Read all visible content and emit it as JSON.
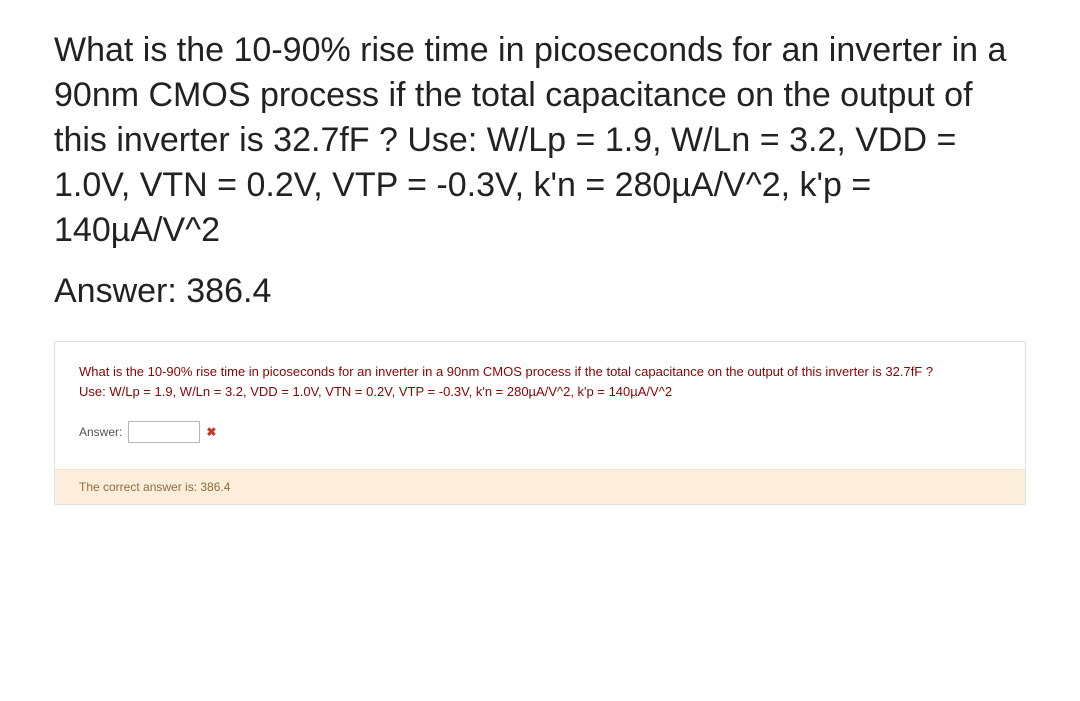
{
  "question": {
    "full_text": "What is the 10-90% rise time in picoseconds for an inverter in a 90nm CMOS process if the total capacitance on the output of this inverter is 32.7fF ? Use: W/Lp = 1.9, W/Ln = 3.2, VDD = 1.0V, VTN = 0.2V, VTP = -0.3V, k'n = 280µA/V^2, k'p = 140µA/V^2"
  },
  "main_answer": {
    "label": "Answer:",
    "value": "386.4",
    "display": "Answer: 386.4"
  },
  "quiz": {
    "question_line1": "What is the 10-90% rise time in picoseconds for an inverter in a 90nm CMOS process if the total capacitance on the output of this inverter is 32.7fF ?",
    "question_line2": "Use: W/Lp = 1.9, W/Ln = 3.2, VDD = 1.0V, VTN = 0.2V, VTP = -0.3V, k'n = 280µA/V^2, k'p = 140µA/V^2",
    "answer_label": "Answer:",
    "input_value": "",
    "feedback": "The correct answer is: 386.4",
    "correct_answer": "386.4"
  }
}
